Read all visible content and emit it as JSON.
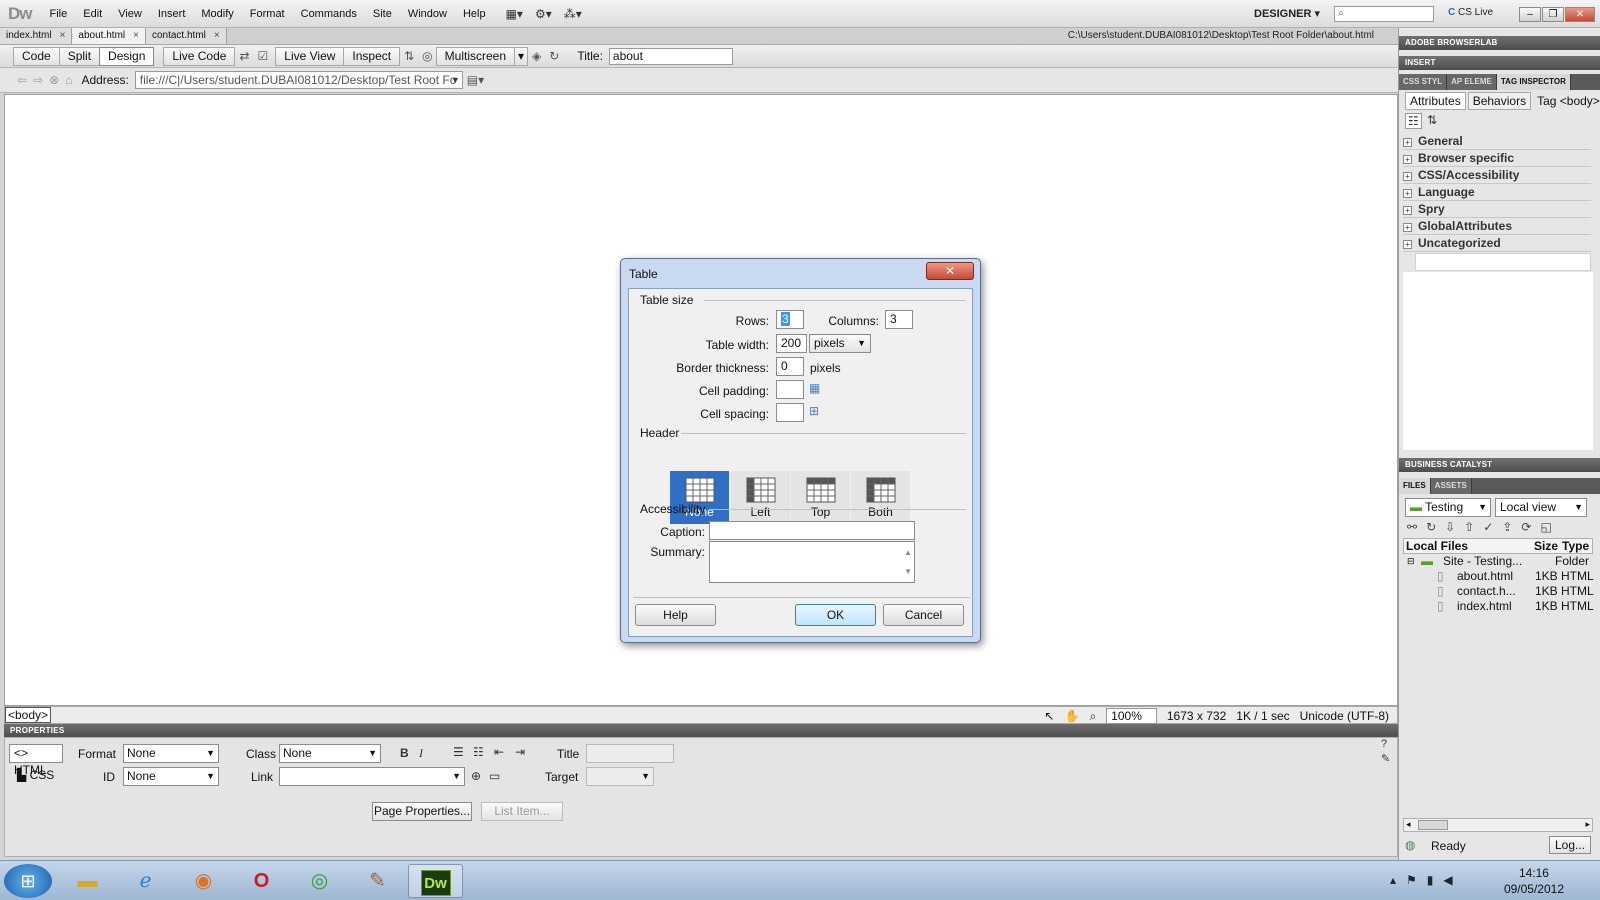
{
  "app": {
    "logo": "Dw",
    "menu": [
      "File",
      "Edit",
      "View",
      "Insert",
      "Modify",
      "Format",
      "Commands",
      "Site",
      "Window",
      "Help"
    ],
    "workspace": "DESIGNER",
    "cs_live": "CS Live"
  },
  "doc_tabs": [
    {
      "label": "index.html",
      "active": false
    },
    {
      "label": "about.html",
      "active": true
    },
    {
      "label": "contact.html",
      "active": false
    }
  ],
  "doc_path": "C:\\Users\\student.DUBAI081012\\Desktop\\Test Root Folder\\about.html",
  "doc_toolbar": {
    "code": "Code",
    "split": "Split",
    "design": "Design",
    "live_code": "Live Code",
    "live_view": "Live View",
    "inspect": "Inspect",
    "multiscreen": "Multiscreen",
    "title_label": "Title:",
    "title_value": "about"
  },
  "address": {
    "label": "Address:",
    "value": "file:///C|/Users/student.DUBAI081012/Desktop/Test Root Fo"
  },
  "status": {
    "tag": "<body>",
    "zoom": "100%",
    "dimensions": "1673 x 732",
    "size": "1K / 1 sec",
    "encoding": "Unicode (UTF-8)"
  },
  "properties": {
    "header": "PROPERTIES",
    "html_label": "<> HTML",
    "css_label": "CSS",
    "format_label": "Format",
    "format_value": "None",
    "class_label": "Class",
    "class_value": "None",
    "id_label": "ID",
    "id_value": "None",
    "link_label": "Link",
    "title_label": "Title",
    "target_label": "Target",
    "bold": "B",
    "italic": "I",
    "page_properties": "Page Properties...",
    "list_item": "List Item..."
  },
  "right_panel": {
    "browserlab": "ADOBE BROWSERLAB",
    "insert": "INSERT",
    "tabs": [
      "CSS STYL",
      "AP ELEME",
      "TAG INSPECTOR"
    ],
    "subtabs": [
      "Attributes",
      "Behaviors"
    ],
    "tag_label": "Tag <body>",
    "categories": [
      "General",
      "Browser specific",
      "CSS/Accessibility",
      "Language",
      "Spry",
      "GlobalAttributes",
      "Uncategorized"
    ],
    "business_catalyst": "BUSINESS CATALYST",
    "files_tabs": [
      "FILES",
      "ASSETS"
    ],
    "site_select": "Testing",
    "view_select": "Local view",
    "files_header": {
      "name": "Local Files",
      "size": "Size",
      "type": "Type"
    },
    "site_row": {
      "name": "Site - Testing...",
      "type": "Folder"
    },
    "files": [
      {
        "name": "about.html",
        "size": "1KB",
        "type": "HTML"
      },
      {
        "name": "contact.h...",
        "size": "1KB",
        "type": "HTML"
      },
      {
        "name": "index.html",
        "size": "1KB",
        "type": "HTML"
      }
    ],
    "status_ready": "Ready",
    "log_button": "Log..."
  },
  "dialog": {
    "title": "Table",
    "table_size": "Table size",
    "rows_label": "Rows:",
    "rows_value": "3",
    "columns_label": "Columns:",
    "columns_value": "3",
    "width_label": "Table width:",
    "width_value": "200",
    "width_unit": "pixels",
    "border_label": "Border thickness:",
    "border_value": "0",
    "border_unit": "pixels",
    "padding_label": "Cell padding:",
    "spacing_label": "Cell spacing:",
    "header_group": "Header",
    "header_options": [
      "None",
      "Left",
      "Top",
      "Both"
    ],
    "header_selected": "None",
    "accessibility": "Accessibility",
    "caption_label": "Caption:",
    "summary_label": "Summary:",
    "help": "Help",
    "ok": "OK",
    "cancel": "Cancel"
  },
  "taskbar": {
    "time": "14:16",
    "date": "09/05/2012",
    "active_app": "Dw"
  }
}
